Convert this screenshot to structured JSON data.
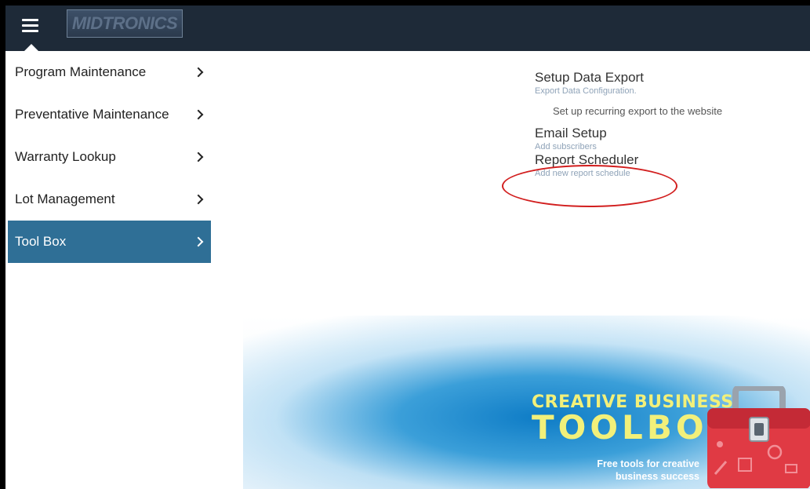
{
  "header": {
    "logo_text": "MIDTRONICS"
  },
  "sidebar": {
    "items": [
      {
        "label": "Program Maintenance"
      },
      {
        "label": "Preventative Maintenance"
      },
      {
        "label": "Warranty Lookup"
      },
      {
        "label": "Lot Management"
      },
      {
        "label": "Tool Box",
        "active": true
      }
    ]
  },
  "main": {
    "cards": [
      {
        "title": "Setup Data Export",
        "subtitle": "Export Data Configuration.",
        "note": "Set up recurring export to the website"
      },
      {
        "title": "Email Setup",
        "subtitle": "Add subscribers"
      },
      {
        "title": "Report Scheduler",
        "subtitle": "Add new report schedule",
        "highlighted": true
      }
    ]
  },
  "banner": {
    "title_line1": "CREATIVE BUSINESS",
    "title_line2": "TOOLBOX",
    "tagline_line1": "Free tools for creative",
    "tagline_line2": "business success"
  },
  "colors": {
    "topbar": "#1e2a38",
    "sidebar_active": "#2f6f96",
    "highlight_circle": "#d21f1f",
    "banner_title": "#f2f07a",
    "toolbox_red": "#e03a44"
  },
  "icons": [
    "hamburger-menu-icon",
    "chevron-right-icon",
    "toolbox-icon"
  ]
}
